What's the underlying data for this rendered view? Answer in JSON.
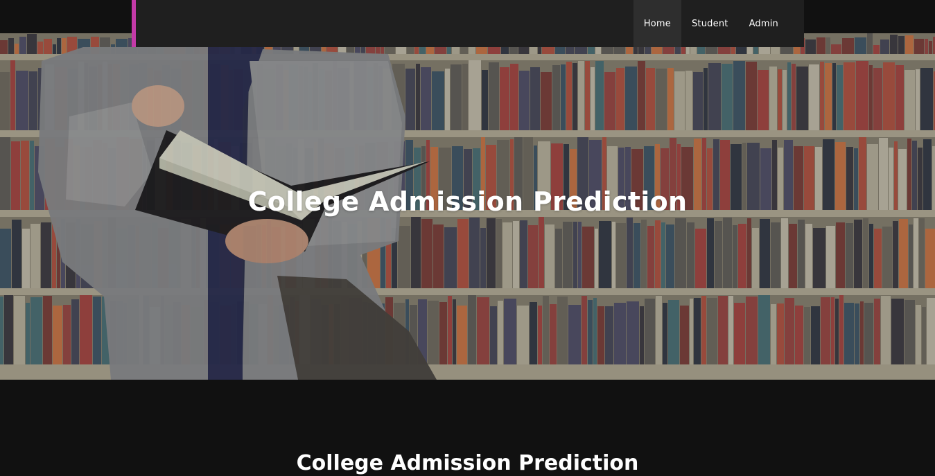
{
  "nav": {
    "items": [
      {
        "label": "Home",
        "active": true
      },
      {
        "label": "Student",
        "active": false
      },
      {
        "label": "Admin",
        "active": false
      }
    ],
    "accent_color": "#c33aa7"
  },
  "hero": {
    "title": "College Admission Prediction",
    "background_image": "student reading book in library-icon"
  },
  "section": {
    "title": "College Admission Prediction"
  }
}
